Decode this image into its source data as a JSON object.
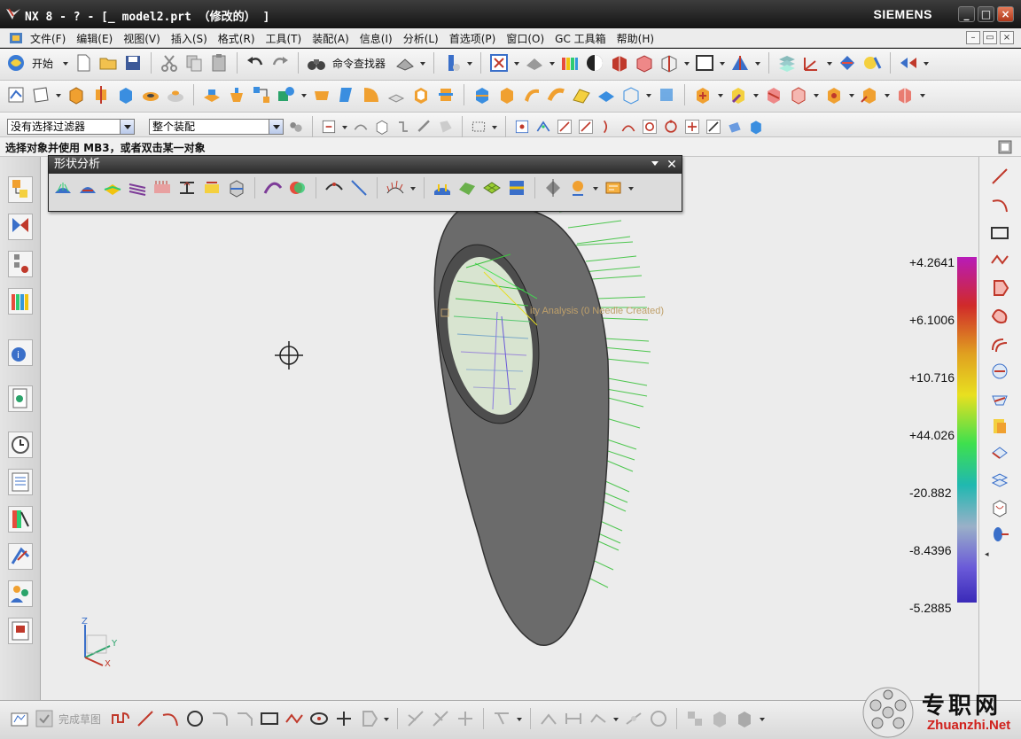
{
  "window": {
    "title": "NX 8 - ? - [_ model2.prt （修改的） ]",
    "brand": "SIEMENS",
    "minimize": "_",
    "maximize": "□",
    "close": "×"
  },
  "menubar": {
    "items": [
      "文件(F)",
      "编辑(E)",
      "视图(V)",
      "插入(S)",
      "格式(R)",
      "工具(T)",
      "装配(A)",
      "信息(I)",
      "分析(L)",
      "首选项(P)",
      "窗口(O)",
      "GC 工具箱",
      "帮助(H)"
    ]
  },
  "toolbar1": {
    "start_label": "开始",
    "command_finder_label": "命令查找器"
  },
  "selection_bar": {
    "filter_value": "没有选择过滤器",
    "scope_value": "整个装配"
  },
  "cue_line": "选择对象并使用 MB3，或者双击某一对象",
  "shape_analysis_palette": {
    "title": "形状分析"
  },
  "viewport": {
    "annotation": "ity Analysis (0 Needle Created)",
    "legend_values": [
      "+4.2641",
      "+6.1006",
      "+10.716",
      "+44.026",
      "-20.882",
      "-8.4396",
      "-5.2885"
    ],
    "triad_labels": {
      "z": "Z",
      "y": "Y",
      "x": "X"
    }
  },
  "bottom_toolbar": {
    "finish_sketch_label": "完成草图"
  },
  "watermark": {
    "cn": "专职网",
    "en": "Zhuanzhi.Net"
  },
  "colors": {
    "titlebar": "#1e1e1e",
    "viewport_bg": "#ececec",
    "part_gray": "#6b6b6b",
    "needle_green": "#35c23a"
  }
}
